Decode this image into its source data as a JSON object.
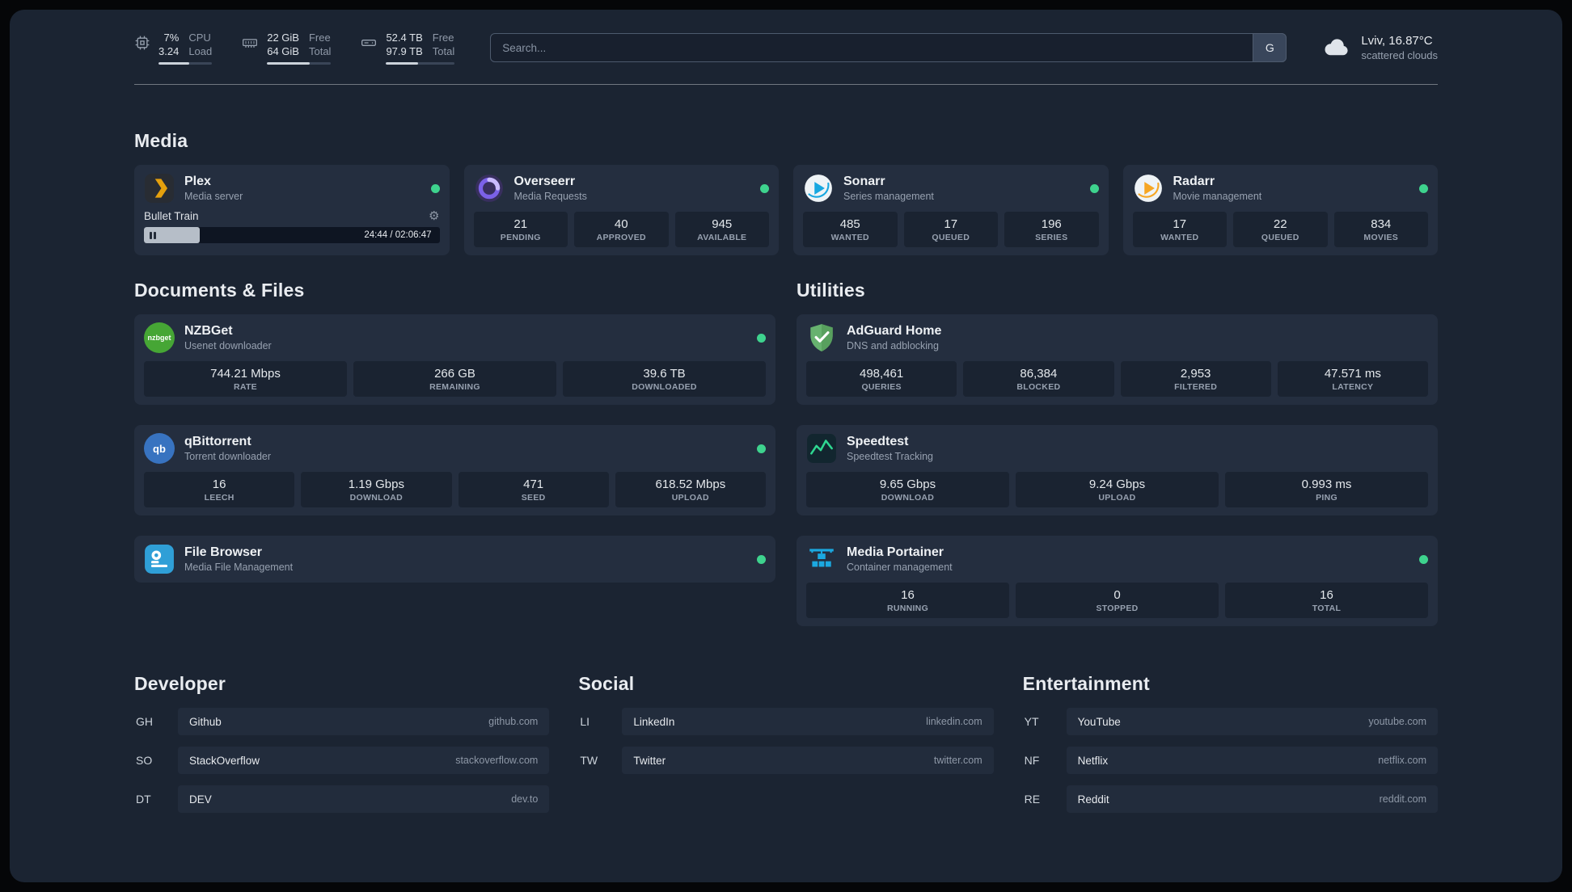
{
  "topbar": {
    "cpu": {
      "value_top": "7%",
      "value_bottom": "3.24",
      "label_top": "CPU",
      "label_bottom": "Load",
      "bar_percent": 58
    },
    "memory": {
      "value_top": "22 GiB",
      "value_bottom": "64 GiB",
      "label_top": "Free",
      "label_bottom": "Total",
      "bar_percent": 66
    },
    "disk": {
      "value_top": "52.4 TB",
      "value_bottom": "97.9 TB",
      "label_top": "Free",
      "label_bottom": "Total",
      "bar_percent": 47
    },
    "search": {
      "placeholder": "Search...",
      "provider": "G"
    },
    "weather": {
      "location": "Lviv, 16.87°C",
      "condition": "scattered clouds"
    }
  },
  "sections": {
    "media": "Media",
    "documents": "Documents & Files",
    "utilities": "Utilities",
    "developer": "Developer",
    "social": "Social",
    "entertainment": "Entertainment"
  },
  "icons": {
    "gear": "⚙"
  },
  "services": {
    "plex": {
      "name": "Plex",
      "subtitle": "Media server",
      "player": {
        "track": "Bullet Train",
        "time": "24:44 / 02:06:47",
        "progress_percent": 19
      }
    },
    "overseerr": {
      "name": "Overseerr",
      "subtitle": "Media Requests",
      "stats": [
        {
          "value": "21",
          "label": "PENDING"
        },
        {
          "value": "40",
          "label": "APPROVED"
        },
        {
          "value": "945",
          "label": "AVAILABLE"
        }
      ]
    },
    "sonarr": {
      "name": "Sonarr",
      "subtitle": "Series management",
      "stats": [
        {
          "value": "485",
          "label": "WANTED"
        },
        {
          "value": "17",
          "label": "QUEUED"
        },
        {
          "value": "196",
          "label": "SERIES"
        }
      ]
    },
    "radarr": {
      "name": "Radarr",
      "subtitle": "Movie management",
      "stats": [
        {
          "value": "17",
          "label": "WANTED"
        },
        {
          "value": "22",
          "label": "QUEUED"
        },
        {
          "value": "834",
          "label": "MOVIES"
        }
      ]
    },
    "nzbget": {
      "name": "NZBGet",
      "subtitle": "Usenet downloader",
      "icon_text": "nzbget",
      "stats": [
        {
          "value": "744.21 Mbps",
          "label": "RATE"
        },
        {
          "value": "266 GB",
          "label": "REMAINING"
        },
        {
          "value": "39.6 TB",
          "label": "DOWNLOADED"
        }
      ]
    },
    "qbittorrent": {
      "name": "qBittorrent",
      "subtitle": "Torrent downloader",
      "icon_text": "qb",
      "stats": [
        {
          "value": "16",
          "label": "LEECH"
        },
        {
          "value": "1.19 Gbps",
          "label": "DOWNLOAD"
        },
        {
          "value": "471",
          "label": "SEED"
        },
        {
          "value": "618.52 Mbps",
          "label": "UPLOAD"
        }
      ]
    },
    "filebrowser": {
      "name": "File Browser",
      "subtitle": "Media File Management"
    },
    "adguard": {
      "name": "AdGuard Home",
      "subtitle": "DNS and adblocking",
      "stats": [
        {
          "value": "498,461",
          "label": "QUERIES"
        },
        {
          "value": "86,384",
          "label": "BLOCKED"
        },
        {
          "value": "2,953",
          "label": "FILTERED"
        },
        {
          "value": "47.571 ms",
          "label": "LATENCY"
        }
      ]
    },
    "speedtest": {
      "name": "Speedtest",
      "subtitle": "Speedtest Tracking",
      "stats": [
        {
          "value": "9.65 Gbps",
          "label": "DOWNLOAD"
        },
        {
          "value": "9.24 Gbps",
          "label": "UPLOAD"
        },
        {
          "value": "0.993 ms",
          "label": "PING"
        }
      ]
    },
    "portainer": {
      "name": "Media Portainer",
      "subtitle": "Container management",
      "stats": [
        {
          "value": "16",
          "label": "RUNNING"
        },
        {
          "value": "0",
          "label": "STOPPED"
        },
        {
          "value": "16",
          "label": "TOTAL"
        }
      ]
    }
  },
  "bookmarks": {
    "developer": [
      {
        "abbr": "GH",
        "name": "Github",
        "url": "github.com"
      },
      {
        "abbr": "SO",
        "name": "StackOverflow",
        "url": "stackoverflow.com"
      },
      {
        "abbr": "DT",
        "name": "DEV",
        "url": "dev.to"
      }
    ],
    "social": [
      {
        "abbr": "LI",
        "name": "LinkedIn",
        "url": "linkedin.com"
      },
      {
        "abbr": "TW",
        "name": "Twitter",
        "url": "twitter.com"
      }
    ],
    "entertainment": [
      {
        "abbr": "YT",
        "name": "YouTube",
        "url": "youtube.com"
      },
      {
        "abbr": "NF",
        "name": "Netflix",
        "url": "netflix.com"
      },
      {
        "abbr": "RE",
        "name": "Reddit",
        "url": "reddit.com"
      }
    ]
  },
  "colors": {
    "online": "#3ed38e",
    "plex_amber": "#e5a00d",
    "panel": "#1b2432"
  }
}
